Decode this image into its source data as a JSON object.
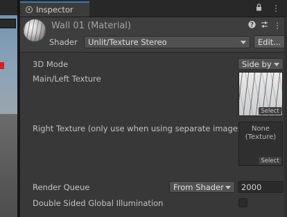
{
  "inspector": {
    "tab_label": "Inspector",
    "tab_icon": "info-icon",
    "tab_actions": [
      "lock-icon",
      "more-options-icon"
    ]
  },
  "material": {
    "title": "Wall 01 (Material)",
    "header_icons": [
      "help-icon",
      "presets-icon",
      "more-options-icon"
    ],
    "shader_label": "Shader",
    "shader_value": "Unlit/Texture Stereo",
    "edit_label": "Edit..."
  },
  "properties": {
    "mode_label": "3D Mode",
    "mode_value": "Side by",
    "main_texture_label": "Main/Left Texture",
    "main_texture_select": "Select",
    "right_texture_label": "Right Texture (only use when using separate images)",
    "right_texture_value": "None\n(Texture)",
    "right_texture_select": "Select",
    "render_queue_label": "Render Queue",
    "render_queue_mode": "From Shader",
    "render_queue_value": "2000",
    "double_sided_label": "Double Sided Global Illumination",
    "double_sided_checked": false
  },
  "colors": {
    "accent": "#3a79bb",
    "panel": "#383838"
  }
}
